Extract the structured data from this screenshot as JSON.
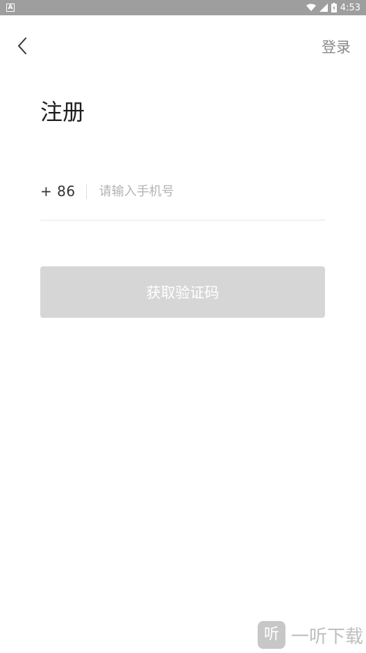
{
  "status_bar": {
    "time": "4:53",
    "notification_icon": "android-notification-icon",
    "wifi_icon": "wifi-icon",
    "signal_icon": "cell-signal-icon",
    "battery_icon": "battery-charging-icon"
  },
  "header": {
    "back_icon": "chevron-left-icon",
    "login_label": "登录"
  },
  "page": {
    "title": "注册"
  },
  "phone_form": {
    "country_code": "+ 86",
    "phone_value": "",
    "phone_placeholder": "请输入手机号"
  },
  "actions": {
    "get_code_label": "获取验证码"
  },
  "watermark": {
    "logo_char": "听",
    "text": "一听下载"
  },
  "colors": {
    "status_bar_bg": "#9e9e9e",
    "button_disabled_bg": "#d6d6d6",
    "muted_text": "#8a8a8a",
    "placeholder": "#b3b3b3"
  }
}
